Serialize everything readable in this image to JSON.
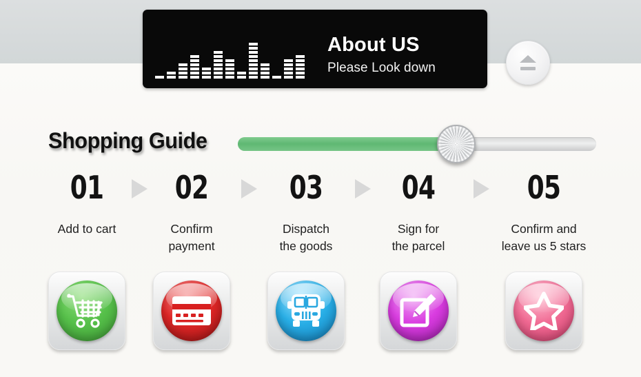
{
  "header": {
    "title": "About US",
    "subtitle": "Please Look down",
    "equalizer_icon": "equalizer-bars-icon",
    "equalizer_levels": [
      1,
      2,
      4,
      6,
      3,
      7,
      5,
      2,
      9,
      4,
      1,
      5,
      6
    ],
    "eject_button": {
      "icon": "eject-icon",
      "label": ""
    }
  },
  "guide": {
    "title": "Shopping Guide",
    "progress": {
      "fill_percent": 61,
      "fill_color": "#5fb873",
      "track_color": "#d5d6d6",
      "knob_icon": "slider-knob-icon"
    }
  },
  "steps": [
    {
      "number": "01",
      "label": "Add to cart",
      "icon": "shopping-cart-icon",
      "color": "#56c04a"
    },
    {
      "number": "02",
      "label": "Confirm\npayment",
      "icon": "credit-card-icon",
      "color": "#de2626"
    },
    {
      "number": "03",
      "label": "Dispatch\nthe goods",
      "icon": "delivery-bus-icon",
      "color": "#28aee6"
    },
    {
      "number": "04",
      "label": "Sign for\nthe parcel",
      "icon": "sign-edit-icon",
      "color": "#d93ce0"
    },
    {
      "number": "05",
      "label": "Confirm and\nleave us 5 stars",
      "icon": "star-icon",
      "color": "#f06a93"
    }
  ],
  "step_labels_lines": [
    [
      "Add to cart"
    ],
    [
      "Confirm",
      "payment"
    ],
    [
      "Dispatch",
      "the goods"
    ],
    [
      "Sign for",
      "the parcel"
    ],
    [
      "Confirm and",
      "leave us 5 stars"
    ]
  ],
  "separators": {
    "icon": "arrow-right-icon",
    "count": 4,
    "color": "#d8d8d8"
  },
  "theme": {
    "background_top": "#d6dadb",
    "background_bottom": "#f9f8f6",
    "panel_background": "#090909",
    "panel_text": "#ffffff",
    "number_color": "#131313"
  }
}
